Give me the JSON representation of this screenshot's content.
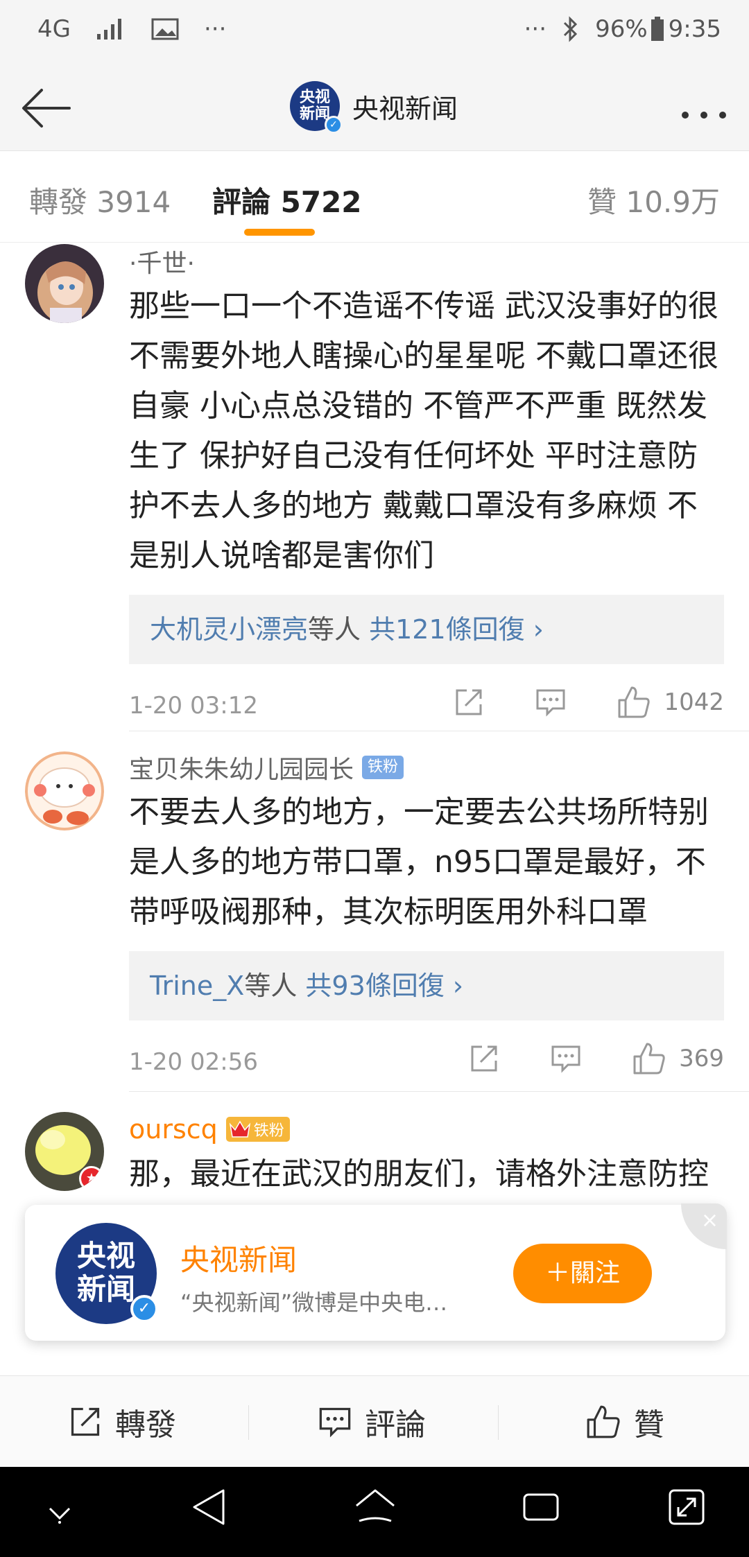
{
  "status": {
    "network": "4G",
    "more_left": "···",
    "more_right": "···",
    "battery": "96%",
    "time": "9:35"
  },
  "nav": {
    "logo_text": "央视新闻",
    "title": "央视新闻"
  },
  "tabs": {
    "repost": "轉發 3914",
    "comments": "評論 5722",
    "likes": "贊 10.9万"
  },
  "comments": [
    {
      "name": "·千世·",
      "text": "那些一口一个不造谣不传谣 武汉没事好的很 不需要外地人瞎操心的星星呢 不戴口罩还很自豪 小心点总没错的 不管严不严重 既然发生了 保护好自己没有任何坏处 平时注意防护不去人多的地方 戴戴口罩没有多麻烦 不是别人说啥都是害你们",
      "reply_user": "大机灵小漂亮",
      "reply_mid": "等人",
      "reply_count": "共121條回復 ›",
      "time": "1-20 03:12",
      "likes": "1042"
    },
    {
      "name": "宝贝朱朱幼儿园园长",
      "badge": "铁粉",
      "text": "不要去人多的地方，一定要去公共场所特别是人多的地方带口罩，n95口罩是最好，不带呼吸阀那种，其次标明医用外科口罩",
      "reply_user": "Trine_X",
      "reply_mid": "等人",
      "reply_count": "共93條回復 ›",
      "time": "1-20 02:56",
      "likes": "369"
    },
    {
      "name": "ourscq",
      "badge": "铁粉",
      "text": "那，最近在武汉的朋友们，请格外注意防控"
    }
  ],
  "follow_card": {
    "logo_text": "央视新闻",
    "name": "央视新闻",
    "desc": "“央视新闻”微博是中央电…",
    "follow_label": "＋關注",
    "close_icon": "×"
  },
  "bottom_bar": {
    "repost": "轉發",
    "comment": "評論",
    "like": "贊"
  },
  "colors": {
    "accent": "#ff8200",
    "link": "#507daf",
    "brand_blue": "#1c3a84"
  }
}
